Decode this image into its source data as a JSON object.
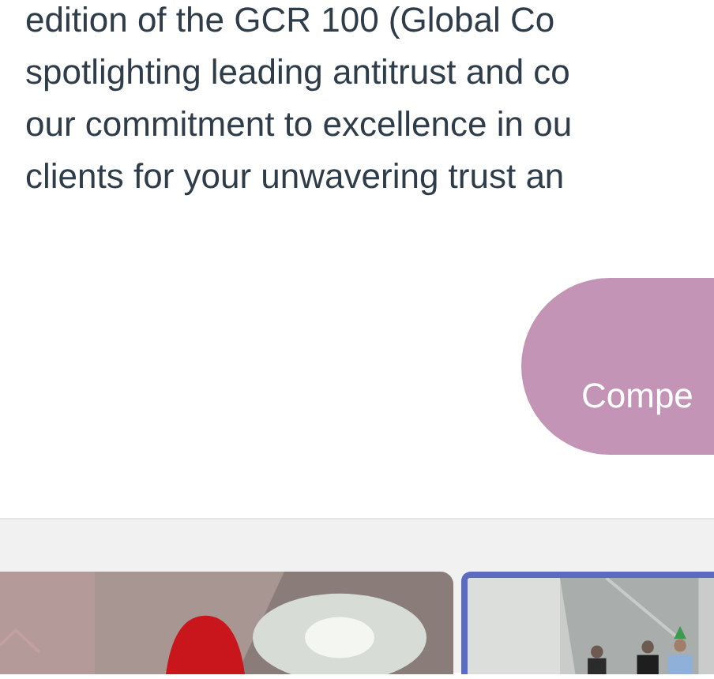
{
  "paragraph_lines": [
    "edition of the GCR 100 (Global Co",
    "spotlighting leading antitrust and co",
    "our commitment to excellence in ou",
    "clients for your unwavering trust an"
  ],
  "button": {
    "label": "Compe"
  },
  "gallery": [
    {
      "kind": "picture",
      "selected": false
    },
    {
      "kind": "picture",
      "selected": true
    }
  ]
}
